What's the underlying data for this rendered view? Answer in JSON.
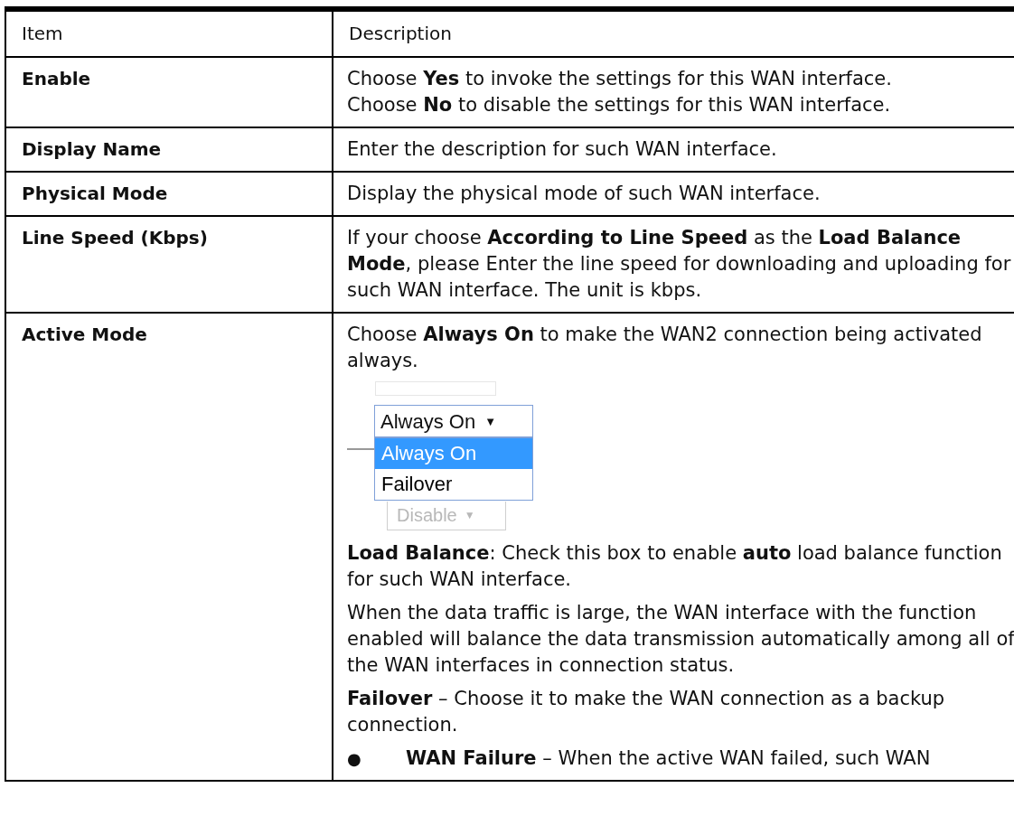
{
  "table": {
    "columns": [
      "Item",
      "Description"
    ],
    "rows": [
      {
        "item": "Enable",
        "description": [
          {
            "kind": "paragraph",
            "text": "Choose **Yes** to invoke the settings for this WAN interface."
          },
          {
            "kind": "line",
            "text": "Choose **No** to disable the settings for this WAN interface."
          }
        ]
      },
      {
        "item": "Display Name",
        "description": [
          {
            "kind": "paragraph",
            "text": "Enter the description for such WAN interface."
          }
        ]
      },
      {
        "item": "Physical Mode",
        "description": [
          {
            "kind": "paragraph",
            "text": "Display the physical mode of such WAN interface."
          }
        ]
      },
      {
        "item": "Line Speed (Kbps)",
        "description": [
          {
            "kind": "paragraph",
            "text": "If your choose **According to Line Speed** as the **Load Balance Mode**, please Enter the line speed for downloading and uploading for such WAN interface. The unit is kbps."
          }
        ]
      },
      {
        "item": "Active Mode",
        "description": [
          {
            "kind": "paragraph",
            "text": "Choose **Always On** to make the WAN2 connection being activated always."
          },
          {
            "kind": "dropdown",
            "value": "Always On",
            "arrow": "▼",
            "options": [
              {
                "label": "Always On",
                "selected": true
              },
              {
                "label": "Failover",
                "selected": false
              }
            ],
            "below_value": "Disable",
            "below_arrow": "▼"
          },
          {
            "kind": "paragraph",
            "text": "**Load Balance**: Check this box to enable **auto** load balance function for such WAN interface."
          },
          {
            "kind": "paragraph",
            "text": "When the data traffic is large, the WAN interface with the function enabled will balance the data transmission automatically among all of the WAN interfaces in connection status."
          },
          {
            "kind": "paragraph",
            "text": "**Failover** – Choose it to make the WAN connection as a backup connection."
          },
          {
            "kind": "bullet",
            "marker": "●",
            "text": "**WAN Failure** – When the active WAN failed, such WAN"
          }
        ]
      }
    ]
  }
}
